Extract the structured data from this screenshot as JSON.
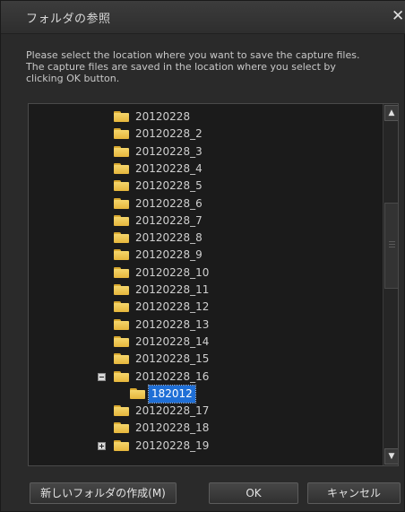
{
  "window": {
    "title": "フォルダの参照",
    "close_label": "✕"
  },
  "instructions": [
    "Please select the location where you want to save the capture files.",
    "The capture files are saved in the location where you select by",
    "clicking OK button."
  ],
  "tree": {
    "items": [
      {
        "label": "20120228"
      },
      {
        "label": "20120228_2"
      },
      {
        "label": "20120228_3"
      },
      {
        "label": "20120228_4"
      },
      {
        "label": "20120228_5"
      },
      {
        "label": "20120228_6"
      },
      {
        "label": "20120228_7"
      },
      {
        "label": "20120228_8"
      },
      {
        "label": "20120228_9"
      },
      {
        "label": "20120228_10"
      },
      {
        "label": "20120228_11"
      },
      {
        "label": "20120228_12"
      },
      {
        "label": "20120228_13"
      },
      {
        "label": "20120228_14"
      },
      {
        "label": "20120228_15"
      },
      {
        "label": "20120228_16",
        "expander": "collapse"
      },
      {
        "label": "182012",
        "child": true,
        "selected": true
      },
      {
        "label": "20120228_17"
      },
      {
        "label": "20120228_18"
      },
      {
        "label": "20120228_19",
        "expander": "expand"
      }
    ]
  },
  "scrollbar": {
    "up_icon": "scroll-up-arrow",
    "down_icon": "scroll-down-arrow"
  },
  "buttons": {
    "new_folder": "新しいフォルダの作成(M)",
    "ok": "OK",
    "cancel": "キャンセル"
  }
}
